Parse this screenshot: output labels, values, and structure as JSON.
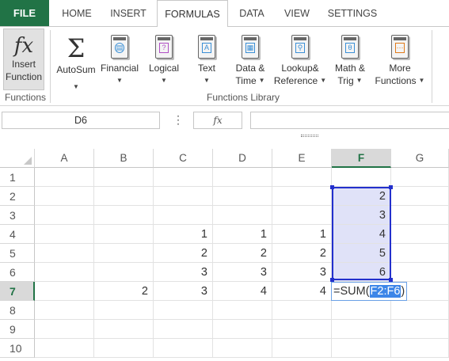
{
  "tabs": {
    "file": "FILE",
    "items": [
      "HOME",
      "INSERT",
      "FORMULAS",
      "DATA",
      "VIEW",
      "SETTINGS"
    ],
    "active": "FORMULAS"
  },
  "ribbon": {
    "insert_function": {
      "line1": "Insert",
      "line2": "Function",
      "icon": "fx"
    },
    "autosum": {
      "label": "AutoSum",
      "icon": "Σ"
    },
    "financial": {
      "label": "Financial",
      "icon": "financial-book-icon"
    },
    "logical": {
      "label": "Logical",
      "icon": "?"
    },
    "text": {
      "label": "Text",
      "icon": "A"
    },
    "datetime": {
      "line1": "Data &",
      "line2": "Time"
    },
    "lookup": {
      "line1": "Lookup&",
      "line2": "Reference"
    },
    "mathtrig": {
      "line1": "Math &",
      "line2": "Trig",
      "icon": "θ"
    },
    "more": {
      "line1": "More",
      "line2": "Functions",
      "icon": "···"
    },
    "group_functions": "Functions",
    "group_library": "Functions Library"
  },
  "formula_bar": {
    "name_box": "D6",
    "fx_label": "fx",
    "formula": ""
  },
  "sheet": {
    "columns": [
      "A",
      "B",
      "C",
      "D",
      "E",
      "F",
      "G"
    ],
    "selected_column": "F",
    "rows": [
      "1",
      "2",
      "3",
      "4",
      "5",
      "6",
      "7",
      "8",
      "9",
      "10"
    ],
    "selected_row": "7",
    "cells": {
      "F2": "2",
      "F3": "3",
      "C4": "1",
      "D4": "1",
      "E4": "1",
      "F4": "4",
      "C5": "2",
      "D5": "2",
      "E5": "2",
      "F5": "5",
      "C6": "3",
      "D6": "3",
      "E6": "3",
      "F6": "6",
      "B7": "2",
      "C7": "3",
      "D7": "4",
      "E7": "4"
    },
    "editing": {
      "prefix": "=SUM(",
      "ref": "F2:F6",
      "suffix": ")"
    }
  },
  "colors": {
    "accent": "#217346",
    "range_fill": "#e0e2f8",
    "range_border": "#2330cc",
    "ref_highlight": "#3d86e8"
  }
}
